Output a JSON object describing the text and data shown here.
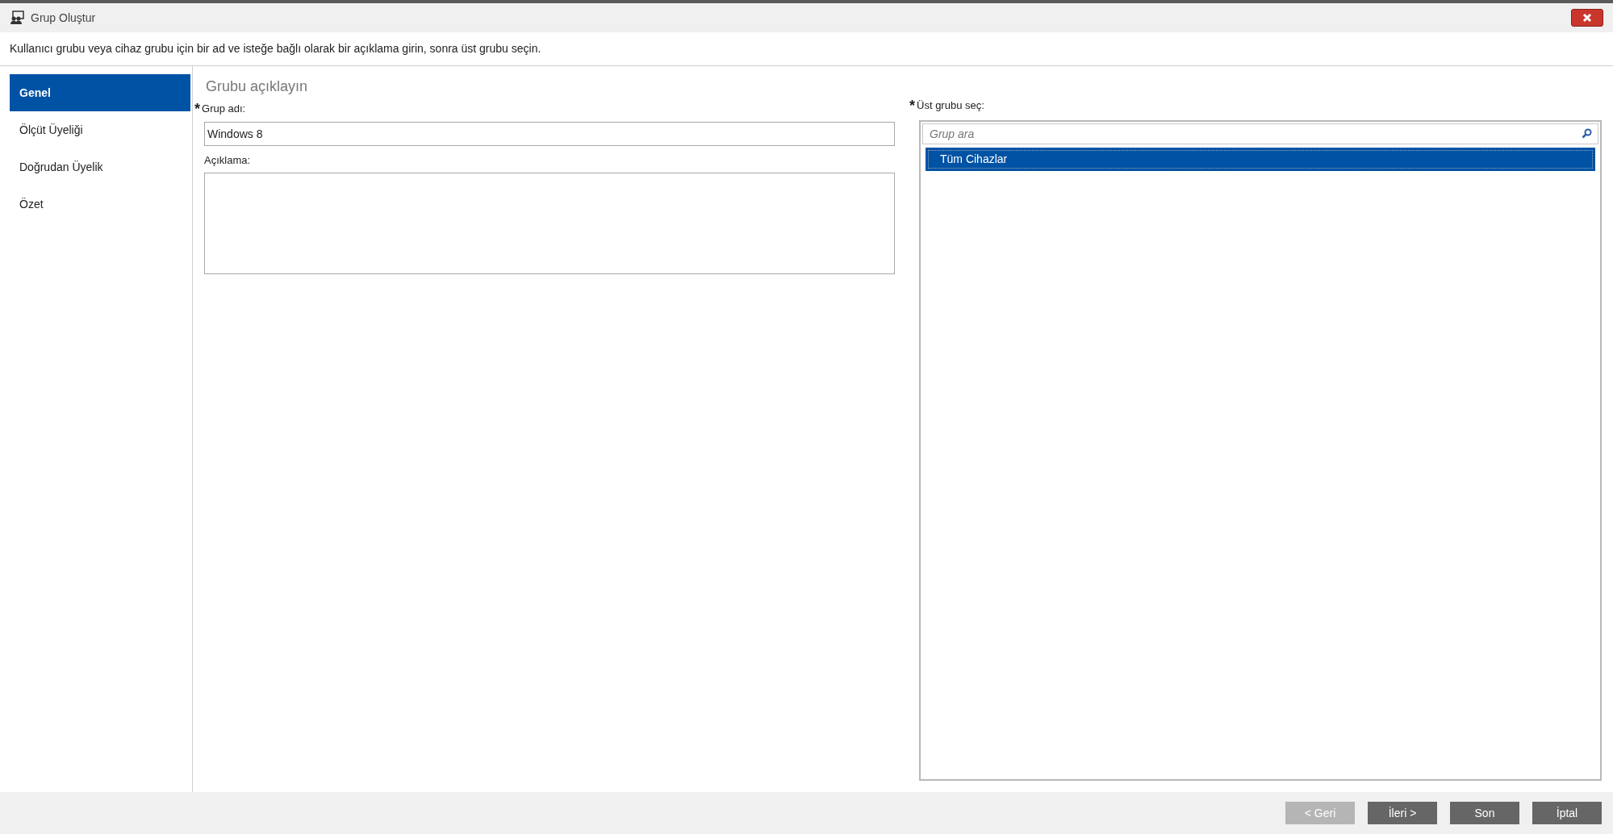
{
  "window": {
    "title": "Grup Oluştur"
  },
  "instruction": "Kullanıcı grubu veya cihaz grubu için bir ad ve isteğe bağlı olarak bir açıklama girin, sonra üst grubu seçin.",
  "sidebar": {
    "items": [
      {
        "label": "Genel",
        "selected": true
      },
      {
        "label": "Ölçüt Üyeliği",
        "selected": false
      },
      {
        "label": "Doğrudan Üyelik",
        "selected": false
      },
      {
        "label": "Özet",
        "selected": false
      }
    ]
  },
  "section_title": "Grubu açıklayın",
  "name_field": {
    "required_mark": "*",
    "label": "Grup adı:",
    "value": "Windows 8"
  },
  "description_field": {
    "label": "Açıklama:"
  },
  "parent_group": {
    "required_mark": "*",
    "label": "Üst grubu seç:",
    "search": {
      "placeholder": "Grup ara"
    },
    "items": [
      {
        "label": "Tüm Cihazlar",
        "selected": true
      }
    ]
  },
  "buttons": [
    {
      "label": "< Geri",
      "disabled": true
    },
    {
      "label": "İleri >",
      "disabled": false
    },
    {
      "label": "Son",
      "disabled": false
    },
    {
      "label": "İptal",
      "disabled": false
    }
  ]
}
